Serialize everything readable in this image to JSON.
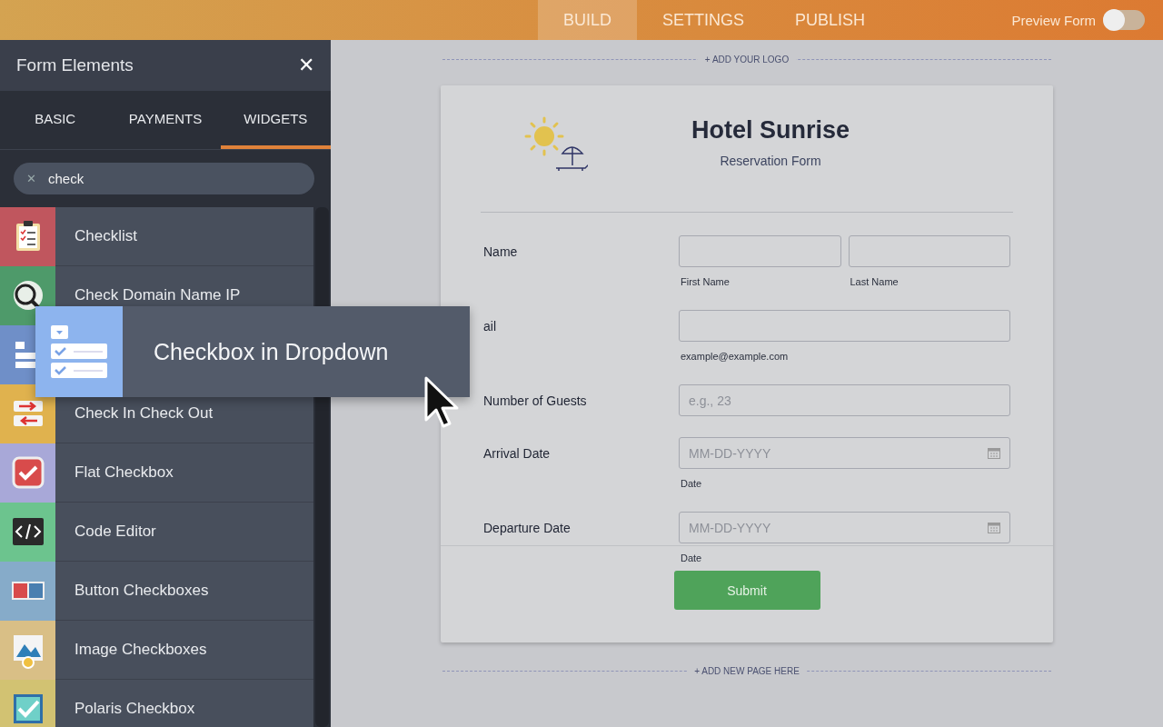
{
  "topbar": {
    "tabs": [
      {
        "label": "BUILD",
        "selected": true
      },
      {
        "label": "SETTINGS",
        "selected": false
      },
      {
        "label": "PUBLISH",
        "selected": false
      }
    ],
    "preview": {
      "label": "Preview Form",
      "on": false
    }
  },
  "sidebar": {
    "title": "Form Elements",
    "close": "✕",
    "tabs": [
      {
        "label": "BASIC",
        "selected": false
      },
      {
        "label": "PAYMENTS",
        "selected": false
      },
      {
        "label": "WIDGETS",
        "selected": true
      }
    ],
    "search": {
      "clear": "✕",
      "value": "check"
    },
    "items": [
      {
        "label": "Checklist",
        "color": "#c0565e"
      },
      {
        "label": "Check Domain Name IP",
        "color": "#4e9a6a"
      },
      {
        "color": "#6f8fc8"
      },
      {
        "label": "Check In Check Out",
        "color": "#e0b24e"
      },
      {
        "label": "Flat Checkbox",
        "color": "#a8a8d8"
      },
      {
        "label": "Code Editor",
        "color": "#6cc48e"
      },
      {
        "label": "Button Checkboxes",
        "color": "#86abc9"
      },
      {
        "label": "Image Checkboxes",
        "color": "#d9bf86"
      },
      {
        "label": "Polaris Checkbox",
        "color": "#d2c272"
      }
    ]
  },
  "dragged": {
    "label": "Checkbox in Dropdown"
  },
  "canvas": {
    "add_logo": "+ ADD YOUR LOGO",
    "add_page": "+ ADD NEW PAGE HERE",
    "form": {
      "title": "Hotel Sunrise",
      "subtitle": "Reservation Form",
      "fields": [
        {
          "label": "Name",
          "inputs": [
            {
              "kind": "text",
              "sublabel": "First Name"
            },
            {
              "kind": "text",
              "sublabel": "Last Name"
            }
          ]
        },
        {
          "label": "ail",
          "inputs": [
            {
              "kind": "text",
              "sublabel": "example@example.com"
            }
          ]
        },
        {
          "label": "Number of Guests",
          "inputs": [
            {
              "kind": "text",
              "placeholder": "e.g., 23"
            }
          ]
        },
        {
          "label": "Arrival Date",
          "inputs": [
            {
              "kind": "date",
              "placeholder": "MM-DD-YYYY",
              "sublabel": "Date"
            }
          ]
        },
        {
          "label": "Departure Date",
          "inputs": [
            {
              "kind": "date",
              "placeholder": "MM-DD-YYYY",
              "sublabel": "Date"
            }
          ]
        }
      ],
      "submit": "Submit"
    }
  }
}
